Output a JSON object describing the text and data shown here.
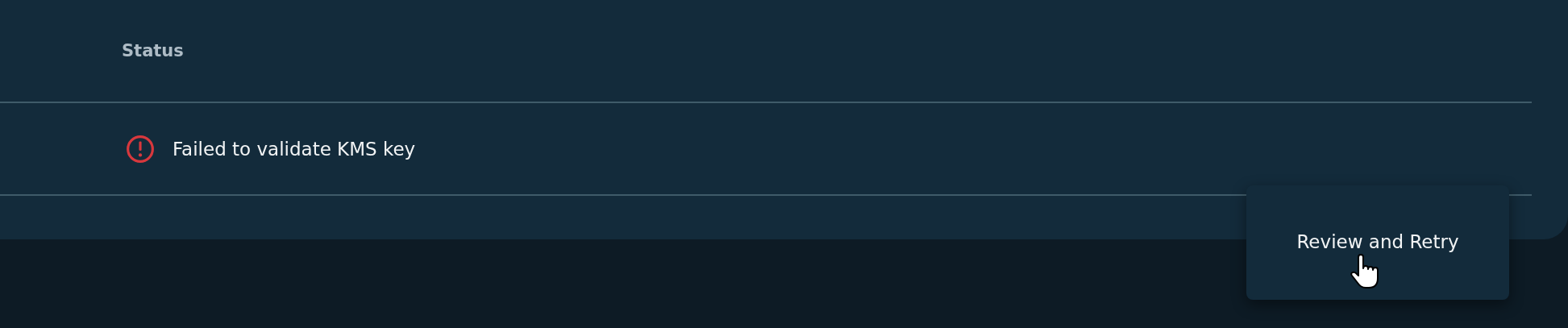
{
  "table": {
    "columns": [
      {
        "label": "Status"
      }
    ],
    "rows": [
      {
        "status": {
          "kind": "error",
          "text": "Failed to validate KMS key"
        }
      }
    ]
  },
  "menu": {
    "items": [
      {
        "label": "Review and Retry"
      }
    ]
  }
}
